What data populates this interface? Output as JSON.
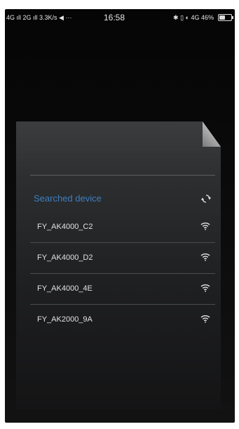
{
  "status_bar": {
    "left": "4G ıll 2G ıll 3.3K/s ◀ ···",
    "time": "16:58",
    "right": "✱ ▯ ◐ 4G 46%",
    "battery_level": 0.46
  },
  "panel": {
    "section_title": "Searched device",
    "refresh_icon": "refresh-icon"
  },
  "devices": [
    {
      "name": "FY_AK4000_C2",
      "icon": "wifi-icon"
    },
    {
      "name": "FY_AK4000_D2",
      "icon": "wifi-icon"
    },
    {
      "name": "FY_AK4000_4E",
      "icon": "wifi-icon"
    },
    {
      "name": "FY_AK2000_9A",
      "icon": "wifi-icon"
    }
  ],
  "colors": {
    "accent": "#3f7fc0",
    "background": "#0a0a0a",
    "text": "#e2e2e2"
  }
}
